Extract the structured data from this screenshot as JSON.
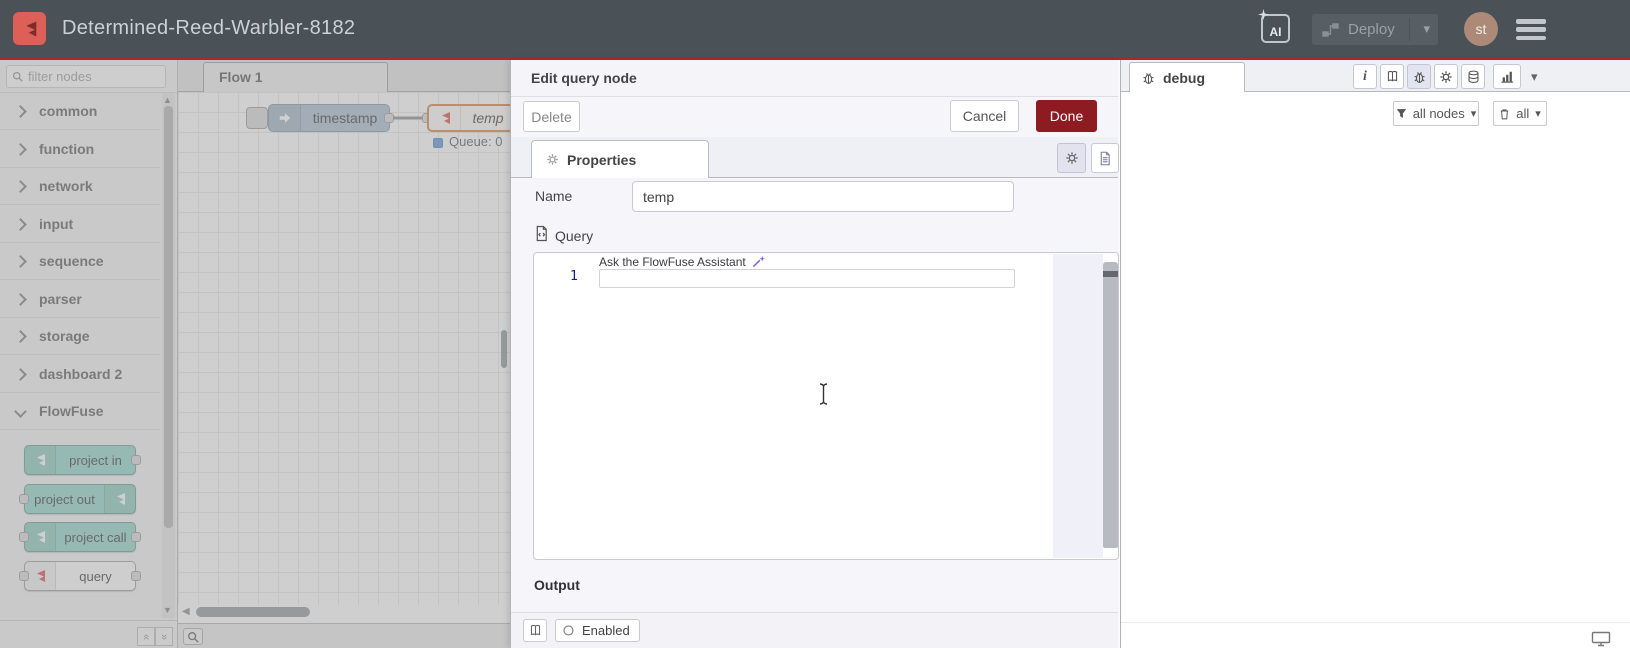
{
  "colors": {
    "header_bg": "#4a5157",
    "header_accent": "#b32525",
    "logo_red": "#dd6058",
    "deploy_btn_bg": "#585f64",
    "avatar_bg": "#ad8a78",
    "done_btn_bg": "#8e1a22",
    "node_teal": "#8fd2c6",
    "node_inject_blue": "#a6bbcf",
    "flowfuse_red": "#d8443c",
    "status_blue": "#5a8fd4",
    "assistant_purple": "#7d57e0",
    "edit_highlight_orange": "#d27c3f"
  },
  "glyphs": {
    "caret_down": "▾",
    "scroll_up": "▲",
    "scroll_down": "▼",
    "scroll_left": "◀",
    "collapse_all": "«",
    "expand_all": "»",
    "info": "i"
  },
  "header": {
    "title": "Determined-Reed-Warbler-8182",
    "ai_label": "AI",
    "deploy_label": "Deploy",
    "avatar_initials": "st"
  },
  "palette": {
    "filter_placeholder": "filter nodes",
    "categories": [
      {
        "label": "common"
      },
      {
        "label": "function"
      },
      {
        "label": "network"
      },
      {
        "label": "input"
      },
      {
        "label": "sequence"
      },
      {
        "label": "parser"
      },
      {
        "label": "storage"
      },
      {
        "label": "dashboard 2"
      },
      {
        "label": "FlowFuse"
      }
    ],
    "flowfuse_nodes": [
      {
        "label": "project in"
      },
      {
        "label": "project out"
      },
      {
        "label": "project call"
      },
      {
        "label": "query"
      }
    ]
  },
  "workspace": {
    "tab_label": "Flow 1",
    "inject_node_label": "timestamp",
    "query_node_label": "temp",
    "query_node_status": "Queue: 0"
  },
  "tray": {
    "title": "Edit query node",
    "delete_label": "Delete",
    "cancel_label": "Cancel",
    "done_label": "Done",
    "properties_tab_label": "Properties",
    "name_label": "Name",
    "name_value": "temp",
    "query_label": "Query",
    "assistant_hint": "Ask the FlowFuse Assistant",
    "line_number": "1",
    "output_label": "Output",
    "enabled_label": "Enabled"
  },
  "sidebar": {
    "tab_label": "debug",
    "filter_button_label": "all nodes",
    "clear_button_label": "all"
  }
}
